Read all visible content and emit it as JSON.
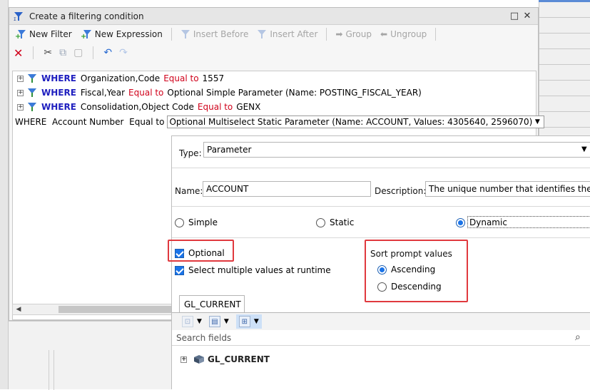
{
  "dialog": {
    "title": "Create a filtering condition"
  },
  "toolbar": {
    "new_filter": "New Filter",
    "new_expression": "New Expression",
    "insert_before": "Insert Before",
    "insert_after": "Insert After",
    "group": "Group",
    "ungroup": "Ungroup"
  },
  "filters": [
    {
      "where": "WHERE",
      "field": "Organization,Code",
      "op": "Equal to",
      "value": "1557"
    },
    {
      "where": "WHERE",
      "field": "Fiscal,Year",
      "op": "Equal to",
      "value": "Optional Simple Parameter (Name: POSTING_FISCAL_YEAR)"
    },
    {
      "where": "WHERE",
      "field": "Consolidation,Object Code",
      "op": "Equal to",
      "value": "GENX"
    }
  ],
  "edit_row": {
    "prefix": "WHERE  Account Number  Equal to",
    "value": "Optional Multiselect Static Parameter (Name: ACCOUNT, Values: 4305640, 2596070)"
  },
  "param": {
    "type_label": "Type:",
    "type_value": "Parameter",
    "name_label": "Name:",
    "name_value": "ACCOUNT",
    "desc_label": "Description:",
    "desc_value": "The unique number that identifies the a",
    "mode_simple": "Simple",
    "mode_static": "Static",
    "mode_dynamic": "Dynamic",
    "optional": "Optional",
    "multi": "Select multiple values at runtime",
    "sort_title": "Sort prompt values",
    "ascending": "Ascending",
    "descending": "Descending",
    "tab": "GL_CURRENT",
    "search_placeholder": "Search fields",
    "tree_root": "GL_CURRENT"
  },
  "colors": {
    "highlight": "#e0393e",
    "keyword": "#1f1fbf",
    "operator": "#d0021b",
    "accent": "#1a73e8"
  }
}
